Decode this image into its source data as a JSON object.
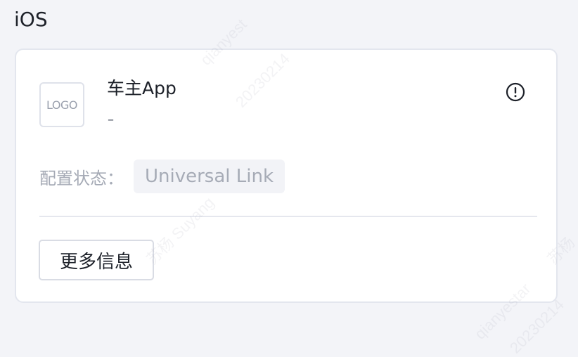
{
  "section": {
    "title": "iOS"
  },
  "app_card": {
    "logo_text": "LOGO",
    "app_name": "车主App",
    "subtitle": "–",
    "info_icon": "exclamation-circle-icon",
    "status_label": "配置状态：",
    "status_value": "Universal Link",
    "more_button_label": "更多信息"
  },
  "watermark": {
    "lines": [
      "qianyest",
      "20230214",
      "苏杨 Suyang",
      "qianyestar",
      "20230214",
      "苏杨"
    ]
  }
}
